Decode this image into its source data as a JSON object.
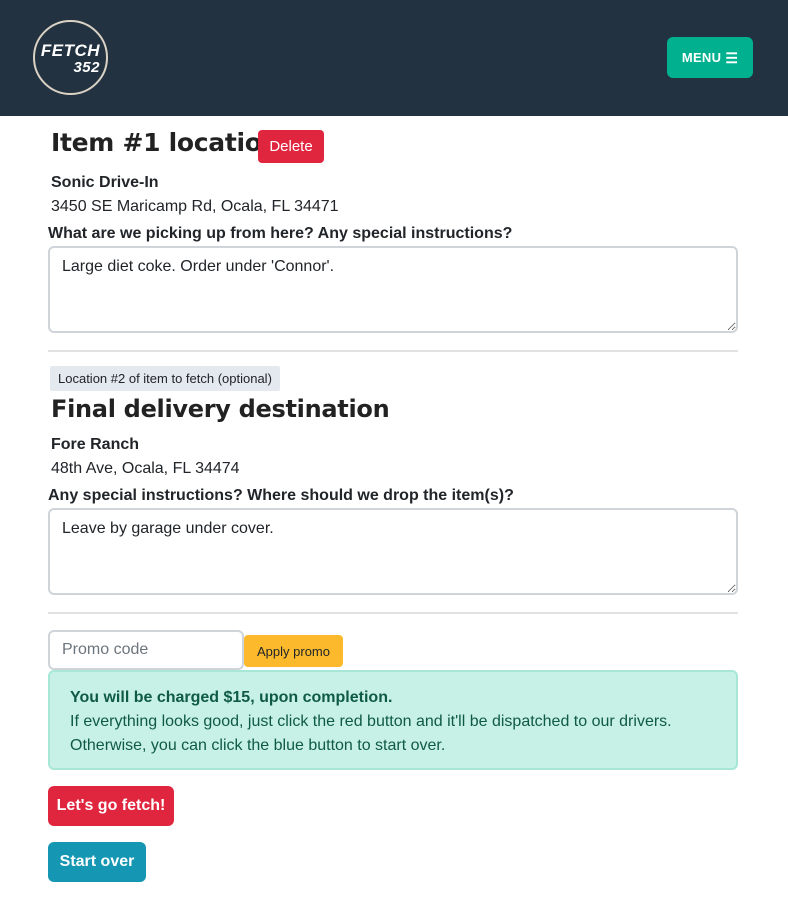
{
  "header": {
    "logo_line1": "FETCH",
    "logo_line2": "352",
    "menu_label": "MENU",
    "menu_icon": "hamburger-icon"
  },
  "pickup": {
    "title": "Item #1 location",
    "delete_label": "Delete",
    "location_name": "Sonic Drive-In",
    "location_address": "3450 SE Maricamp Rd, Ocala, FL 34471",
    "instructions_label": "What are we picking up from here? Any special instructions?",
    "instructions_value": "Large diet coke. Order under 'Connor'."
  },
  "optional_badge": "Location #2 of item to fetch (optional)",
  "destination": {
    "title": "Final delivery destination",
    "location_name": "Fore Ranch",
    "location_address": "48th Ave, Ocala, FL 34474",
    "instructions_label": "Any special instructions? Where should we drop the item(s)?",
    "instructions_value": "Leave by garage under cover."
  },
  "promo": {
    "placeholder": "Promo code",
    "apply_label": "Apply promo"
  },
  "alert": {
    "heading": "You will be charged $15, upon completion.",
    "line1": "If everything looks good, just click the red button and it'll be dispatched to our drivers.",
    "line2": "Otherwise, you can click the blue button to start over."
  },
  "actions": {
    "go_label": "Let's go fetch!",
    "start_over_label": "Start over"
  },
  "colors": {
    "navbar": "#233240",
    "menu_button": "#00b08f",
    "danger": "#e0263e",
    "warning": "#fcb92c",
    "info": "#1597b3",
    "alert_bg": "#c7f0e6"
  }
}
